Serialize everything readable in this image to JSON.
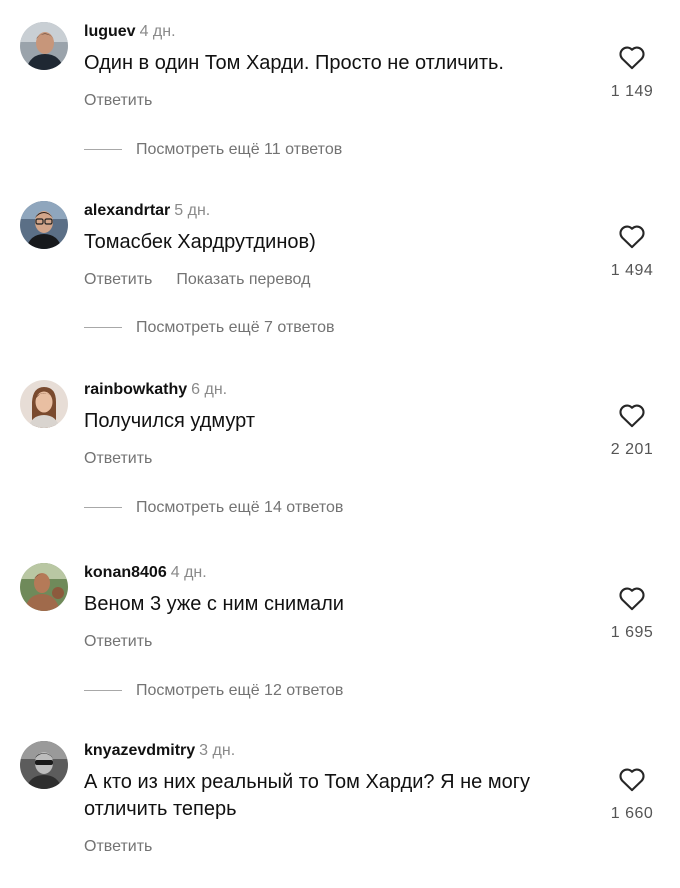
{
  "comments": [
    {
      "username": "luguev",
      "time": "4 дн.",
      "text": "Один в один Том Харди. Просто не отличить.",
      "reply_label": "Ответить",
      "translate_label": "",
      "likes": "1 149",
      "view_replies": "Посмотреть ещё 11 ответов",
      "avatar_icon": "man-in-dark-shirt-avatar"
    },
    {
      "username": "alexandrtar",
      "time": "5 дн.",
      "text": "Томасбек Хардрутдинов)",
      "reply_label": "Ответить",
      "translate_label": "Показать перевод",
      "likes": "1 494",
      "view_replies": "Посмотреть ещё 7 ответов",
      "avatar_icon": "man-with-glasses-avatar"
    },
    {
      "username": "rainbowkathy",
      "time": "6 дн.",
      "text": "Получился удмурт",
      "reply_label": "Ответить",
      "translate_label": "",
      "likes": "2 201",
      "view_replies": "Посмотреть ещё 14 ответов",
      "avatar_icon": "woman-with-long-hair-avatar"
    },
    {
      "username": "konan8406",
      "time": "4 дн.",
      "text": "Веном 3 уже с ним снимали",
      "reply_label": "Ответить",
      "translate_label": "",
      "likes": "1 695",
      "view_replies": "Посмотреть ещё 12 ответов",
      "avatar_icon": "man-outdoors-avatar"
    },
    {
      "username": "knyazevdmitry",
      "time": "3 дн.",
      "text": "А кто из них реальный то Том Харди? Я не могу отличить теперь",
      "reply_label": "Ответить",
      "translate_label": "",
      "likes": "1 660",
      "view_replies": "",
      "avatar_icon": "man-in-sunglasses-avatar"
    }
  ],
  "colors": {
    "text": "#111111",
    "secondary": "#737373",
    "timestamp": "#8a8a8a",
    "divider": "#a8a8a8",
    "background": "#ffffff"
  },
  "icons": [
    "heart-outline-icon"
  ]
}
